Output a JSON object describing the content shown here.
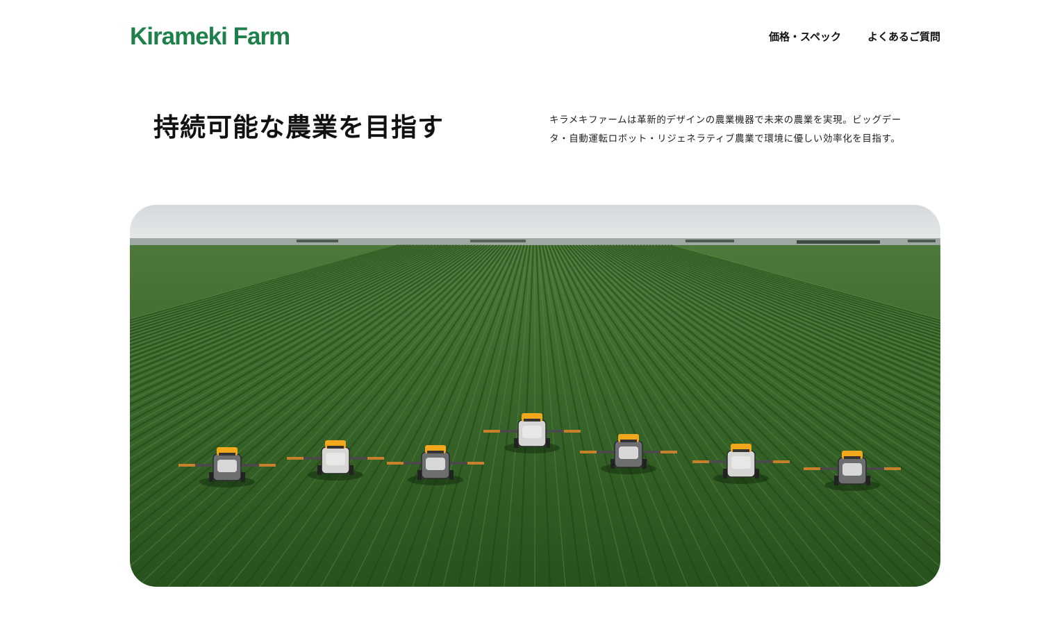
{
  "header": {
    "logo": "Kirameki Farm",
    "nav": [
      {
        "label": "価格・スペック"
      },
      {
        "label": "よくあるご質問"
      }
    ]
  },
  "hero": {
    "headline": "持続可能な農業を目指す",
    "description": "キラメキファームは革新的デザインの農業機器で未来の農業を実現。ビッグデータ・自動運転ロボット・リジェネラティブ農業で環境に優しい効率化を目指す。"
  },
  "image": {
    "subject": "aerial-green-field-with-seven-autonomous-sprayers",
    "vehicle_count": 7
  },
  "colors": {
    "brand": "#1e7f4a",
    "text": "#111111",
    "field": "#2f5e22",
    "sky": "#dfe3e4",
    "vehicle_accent": "#f2a81d"
  }
}
